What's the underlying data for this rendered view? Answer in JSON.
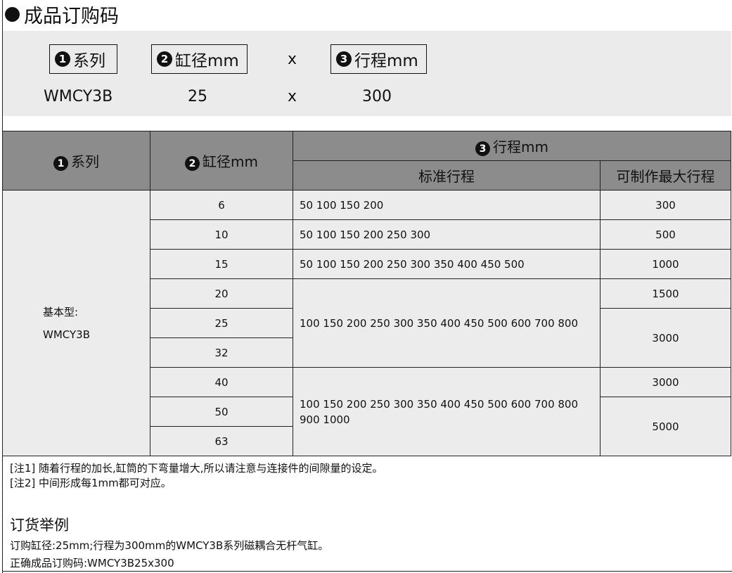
{
  "heading": "成品订购码",
  "code_labels": {
    "num1": "1",
    "series": "系列",
    "num2": "2",
    "bore": "缸径mm",
    "x": "x",
    "num3": "3",
    "stroke": "行程mm"
  },
  "code_example": {
    "series": "WMCY3B",
    "bore": "25",
    "x": "x",
    "stroke": "300"
  },
  "table": {
    "headers": {
      "num1": "1",
      "series": "系列",
      "num2": "2",
      "bore": "缸径mm",
      "num3": "3",
      "stroke": "行程mm",
      "standard": "标准行程",
      "max": "可制作最大行程"
    },
    "series_line1": "基本型:",
    "series_line2": "WMCY3B",
    "bores": [
      "6",
      "10",
      "15",
      "20",
      "25",
      "32",
      "40",
      "50",
      "63"
    ],
    "strokes": [
      "50 100 150 200",
      "50 100 150 200 250 300",
      "50 100 150 200 250 300 350 400 450 500",
      "100 150 200 250 300 350 400 450 500 600 700 800",
      "100 150 200 250 300 350 400 450 500 600 700 800 900 1000"
    ],
    "max": [
      "300",
      "500",
      "1000",
      "1500",
      "3000",
      "3000",
      "5000"
    ]
  },
  "notes": [
    "[注1] 随着行程的加长,缸筒的下弯量增大,所以请注意与连接件的间隙量的设定。",
    "[注2] 中间形成每1mm都可对应。"
  ],
  "order_example": {
    "title": "订货举例",
    "line1": "订购缸径:25mm;行程为300mm的WMCY3B系列磁耦合无杆气缸。",
    "line2": "正确成品订购码:WMCY3B25x300"
  }
}
